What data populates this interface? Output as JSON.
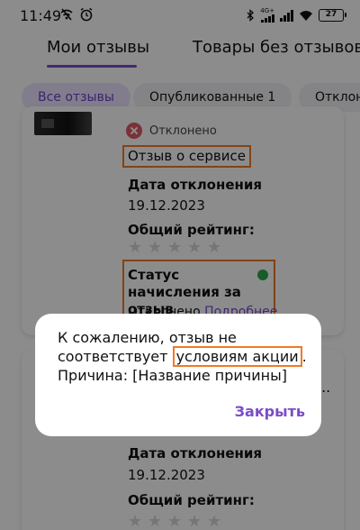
{
  "status_bar": {
    "time": "11:49",
    "network": "4G+",
    "battery": "27"
  },
  "tabs": {
    "mine": "Мои отзывы",
    "without": "Товары без отзывов"
  },
  "filters": {
    "all": "Все отзывы",
    "published": "Опубликованные 1",
    "rejected": "Отклоне"
  },
  "review": {
    "status": "Отклонено",
    "type": "Отзыв о сервисе",
    "reject_date_label": "Дата отклонения",
    "reject_date": "19.12.2023",
    "rating_label": "Общий рейтинг:",
    "rating": 0,
    "credit_label": "Статус начисления за отзыв",
    "credit_status": "Отклонено",
    "credit_more": "Подробнее"
  },
  "review2": {
    "reject_date_label": "Дата отклонения",
    "reject_date": "19.12.2023",
    "rating_label": "Общий рейтинг:",
    "dots": "..."
  },
  "dialog": {
    "text_before": "К сожалению, отзыв не соответствует ",
    "text_highlight": "условиям акции",
    "text_after": ". Причина: [Название причины]",
    "close_label": "Закрыть"
  },
  "colors": {
    "accent": "#7b4bc8",
    "highlight": "#f07a26",
    "reject": "#e05a64",
    "credit_ok": "#2fa84f"
  }
}
